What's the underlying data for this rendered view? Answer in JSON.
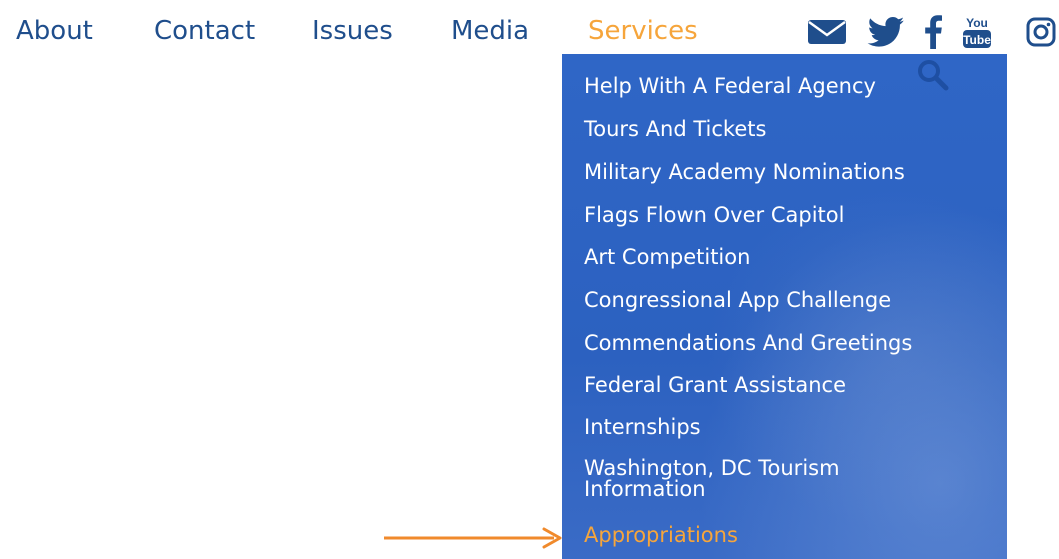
{
  "nav": {
    "about": "About",
    "contact": "Contact",
    "issues": "Issues",
    "media": "Media",
    "services": "Services"
  },
  "social": {
    "youtube_top": "You",
    "youtube_bottom": "Tube"
  },
  "dropdown": {
    "items": [
      "Help With A Federal Agency",
      "Tours And Tickets",
      "Military Academy Nominations",
      "Flags Flown Over Capitol",
      "Art Competition",
      "Congressional App Challenge",
      "Commendations And Greetings",
      "Federal Grant Assistance",
      "Internships",
      "Washington, DC Tourism Information",
      "Appropriations"
    ]
  },
  "colors": {
    "nav_text": "#1f4e8c",
    "active": "#f6a53b",
    "dropdown_bg": "#2f66c6",
    "arrow": "#f08a2c"
  }
}
